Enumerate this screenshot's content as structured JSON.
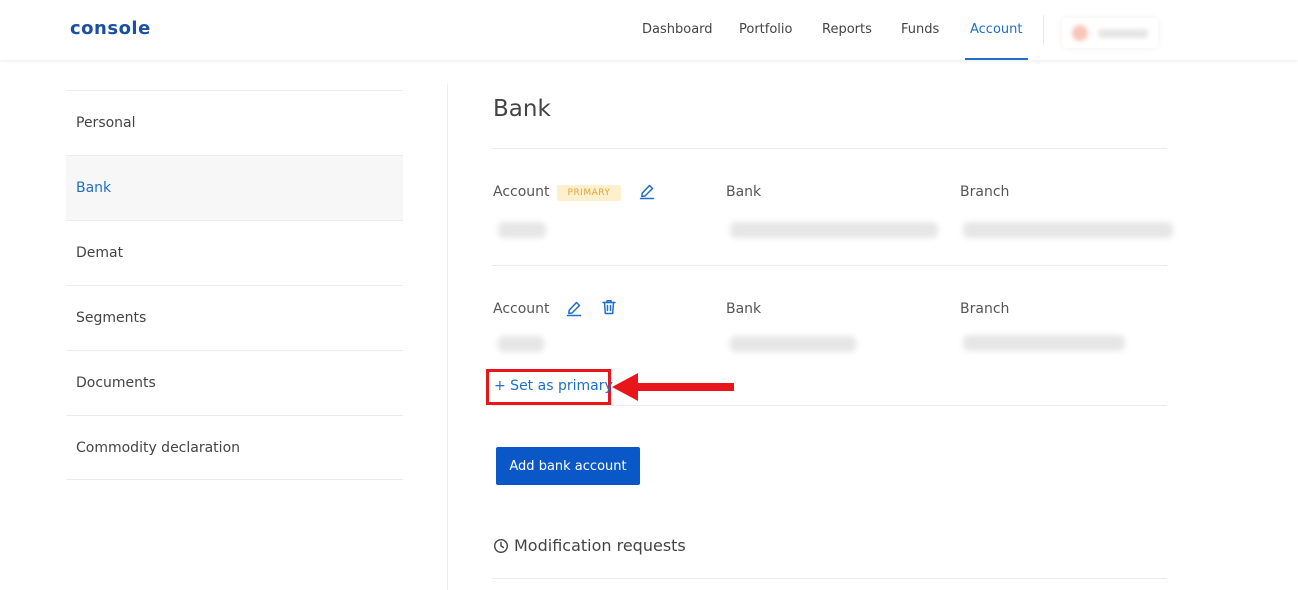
{
  "header": {
    "logo": "console",
    "nav": [
      "Dashboard",
      "Portfolio",
      "Reports",
      "Funds",
      "Account"
    ],
    "active_nav": "Account"
  },
  "sidebar": {
    "items": [
      {
        "label": "Personal"
      },
      {
        "label": "Bank"
      },
      {
        "label": "Demat"
      },
      {
        "label": "Segments"
      },
      {
        "label": "Documents"
      },
      {
        "label": "Commodity declaration"
      }
    ],
    "active": "Bank"
  },
  "main": {
    "title": "Bank",
    "accounts": [
      {
        "account_label": "Account",
        "bank_label": "Bank",
        "branch_label": "Branch",
        "badge": "PRIMARY"
      },
      {
        "account_label": "Account",
        "bank_label": "Bank",
        "branch_label": "Branch",
        "set_primary": "+ Set as primary"
      }
    ],
    "add_button": "Add bank account",
    "modification_title": "Modification requests"
  },
  "colors": {
    "accent": "#1f6fc9",
    "button": "#0a58c8",
    "badge_bg": "#fdf0cc",
    "badge_text": "#e6a23c",
    "annotation": "#e8161b"
  },
  "icons": [
    "edit-icon",
    "trash-icon",
    "clock-icon",
    "arrow-annotation"
  ]
}
